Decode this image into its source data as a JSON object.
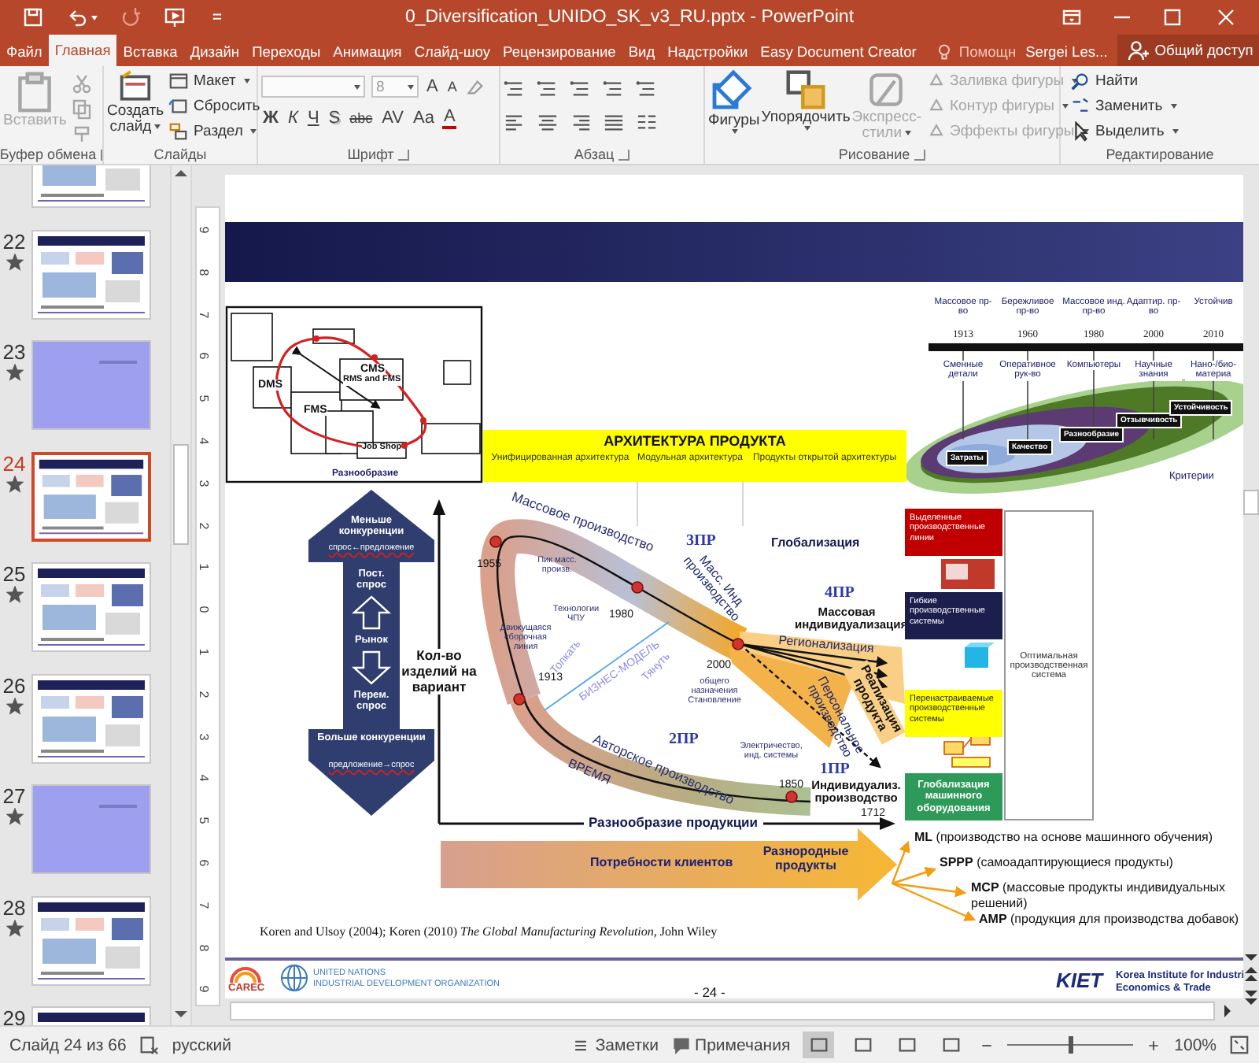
{
  "window": {
    "title": "0_Diversification_UNIDO_SK_v3_RU.pptx - PowerPoint"
  },
  "tabs": [
    {
      "label": "Файл",
      "selected": false
    },
    {
      "label": "Главная",
      "selected": true
    },
    {
      "label": "Вставка",
      "selected": false
    },
    {
      "label": "Дизайн",
      "selected": false
    },
    {
      "label": "Переходы",
      "selected": false
    },
    {
      "label": "Анимация",
      "selected": false
    },
    {
      "label": "Слайд-шоу",
      "selected": false
    },
    {
      "label": "Рецензирование",
      "selected": false
    },
    {
      "label": "Вид",
      "selected": false
    },
    {
      "label": "Надстройки",
      "selected": false
    },
    {
      "label": "Easy Document Creator",
      "selected": false
    }
  ],
  "tell_me": "Помощн",
  "user": "Sergei Les...",
  "share": "Общий доступ",
  "ribbon": {
    "clipboard": {
      "label": "Буфер обмена",
      "paste": {
        "label": "Вставить",
        "disabled": true
      }
    },
    "slides": {
      "label": "Слайды",
      "new_slide": "Создать слайд",
      "layout": "Макет",
      "reset": "Сбросить",
      "section": "Раздел"
    },
    "font": {
      "label": "Шрифт",
      "size": "8",
      "buttons": [
        {
          "label": "A",
          "kind": "grow"
        },
        {
          "label": "A",
          "kind": "shrink"
        },
        {
          "label": "Ж",
          "kind": "bold"
        },
        {
          "label": "К",
          "kind": "italic"
        },
        {
          "label": "Ч",
          "kind": "underline"
        },
        {
          "label": "S",
          "kind": "shadow"
        },
        {
          "label": "abc",
          "kind": "strike"
        },
        {
          "label": "AV",
          "kind": "spacing"
        },
        {
          "label": "Aa",
          "kind": "case"
        },
        {
          "label": "A",
          "kind": "color"
        }
      ]
    },
    "paragraph": {
      "label": "Абзац"
    },
    "drawing": {
      "label": "Рисование",
      "shapes": "Фигуры",
      "arrange": "Упорядочить",
      "quick_styles": {
        "label": "Экспресс-стили",
        "disabled": true
      },
      "fill": {
        "label": "Заливка фигуры",
        "disabled": true
      },
      "outline": {
        "label": "Контур фигуры",
        "disabled": true
      },
      "effects": {
        "label": "Эффекты фигуры",
        "disabled": true
      }
    },
    "editing": {
      "label": "Редактирование",
      "find": "Найти",
      "replace": "Заменить",
      "select": "Выделить"
    }
  },
  "thumbnails": [
    {
      "kind": "content",
      "selected": false
    },
    {
      "number": "22",
      "kind": "content",
      "starred": true,
      "selected": false
    },
    {
      "number": "23",
      "kind": "section",
      "starred": true,
      "selected": false
    },
    {
      "number": "24",
      "kind": "content",
      "starred": true,
      "selected": true
    },
    {
      "number": "25",
      "kind": "content",
      "starred": true,
      "selected": false
    },
    {
      "number": "26",
      "kind": "content",
      "starred": true,
      "selected": false
    },
    {
      "number": "27",
      "kind": "section",
      "starred": true,
      "selected": false
    },
    {
      "number": "28",
      "kind": "content",
      "starred": true,
      "selected": false
    },
    {
      "number": "29",
      "kind": "content",
      "selected": false
    }
  ],
  "ruler_marks": [
    "9",
    "8",
    "7",
    "6",
    "5",
    "4",
    "3",
    "2",
    "1",
    "0",
    "1",
    "2",
    "3",
    "4",
    "5",
    "6",
    "7",
    "8",
    "9"
  ],
  "slide": {
    "systems_diagram": {
      "labels": [
        "CMS",
        "RMS and FMS",
        "DMS",
        "FMS",
        "Job Shop",
        "Разнообразие"
      ]
    },
    "architecture": {
      "title": "АРХИТЕКТУРА ПРОДУКТА",
      "columns": [
        "Унифицированная архитектура",
        "Модульная архитектура",
        "Продукты открытой архитектуры"
      ]
    },
    "timeline": {
      "stages": [
        {
          "label": "Массовое пр-во",
          "year": "1913",
          "feature": "Сменные детали",
          "criterion": "Затраты"
        },
        {
          "label": "Бережливое пр-во",
          "year": "1960",
          "feature": "Оперативное рук-во",
          "criterion": "Качество"
        },
        {
          "label": "Массовое инд. пр-во",
          "year": "1980",
          "feature": "Компьютеры",
          "criterion": "Разнообразие"
        },
        {
          "label": "Адаптир. пр-во",
          "year": "2000",
          "feature": "Научные знания",
          "criterion": "Отзывчивость"
        },
        {
          "label": "Устойчив",
          "year": "2010",
          "feature": "Нано-/био-материа",
          "criterion": "Устойчивость"
        }
      ],
      "criteria_label": "Критерии"
    },
    "market_arrow": {
      "labels": [
        "Меньше конкуренции",
        "спрос←предложение",
        "Пост. спрос",
        "Рынок",
        "Перем. спрос",
        "Больше конкуренции",
        "предложение→спрос"
      ]
    },
    "evolution": {
      "y_label": "Кол-во изделий на вариант",
      "x_label": "Разнообразие продукции",
      "labels": [
        "Массовое производство",
        "1955",
        "Пик масс. произв.",
        "Технологии ЧПУ",
        "1980",
        "3ПР",
        "Масс. Инд производство",
        "Глобализация",
        "4ПР",
        "Массовая индивидуализация",
        "Движущаяся сборочная линия",
        "Толкать",
        "БИЗНЕС-МОДЕЛЬ",
        "Тянуть",
        "1913",
        "2000",
        "общего назначения Становление",
        "Регионализация",
        "Персональное производство",
        "Реализация продукта",
        "2ПР",
        "Авторское производство",
        "ВРЕМЯ",
        "Электричество, инд. системы",
        "1850",
        "1ПР",
        "Индивидуализ. производство",
        "1712"
      ]
    },
    "systems": [
      {
        "label": "Выделенные производственные линии",
        "color": "#c00000"
      },
      {
        "label": "Гибкие производственные системы",
        "color": "#1c1f4e"
      },
      {
        "label": "Перенастраиваемые производственные системы",
        "color": "#ffff00"
      },
      {
        "label": "Глобализация машинного оборудования",
        "color": "#2e9a5a"
      }
    ],
    "optimal_system": "Оптимальная производственная система",
    "customer_arrow": {
      "needs": "Потребности клиентов",
      "products": "Разнородные продукты"
    },
    "future": [
      "**ML** (производство на основе машинного обучения)",
      "**SPPP** (самоадаптирующиеся продукты)",
      "**MCP** (массовые продукты индивидуальных решений)",
      "**AMP** (продукция для производства добавок)"
    ],
    "citation": "Koren and Ulsoy (2004); Koren (2010) *The Global Manufacturing Revolution*, John Wiley",
    "footer": {
      "carec": "CAREC",
      "unido": [
        "UNITED NATIONS",
        "INDUSTRIAL DEVELOPMENT ORGANIZATION"
      ],
      "page": "- 24 -",
      "kiet": "KIET",
      "kiet_name": [
        "Korea Institute for Industri",
        "Economics & Trade"
      ]
    }
  },
  "status_bar": {
    "slide": "Слайд 24 из 66",
    "language": "русский",
    "notes": "Заметки",
    "comments": "Примечания",
    "views": [
      {
        "selected": true
      },
      {
        "selected": false
      },
      {
        "selected": false
      },
      {
        "selected": false
      }
    ],
    "zoom": {
      "level": 0.5,
      "reading": "100%"
    }
  }
}
